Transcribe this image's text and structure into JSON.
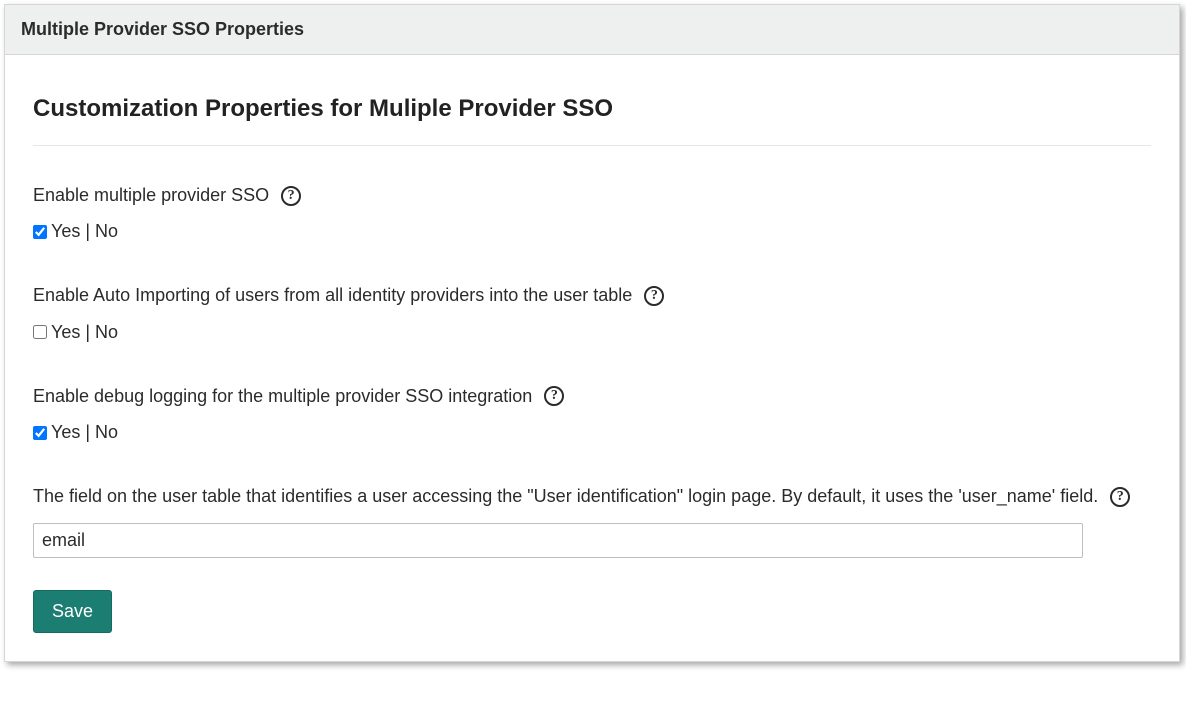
{
  "header": {
    "title": "Multiple Provider SSO Properties"
  },
  "section": {
    "title": "Customization Properties for Muliple Provider SSO"
  },
  "fields": {
    "enableSSO": {
      "label": "Enable multiple provider SSO",
      "yesNoText": "Yes | No",
      "checked": true
    },
    "enableAutoImport": {
      "label": "Enable Auto Importing of users from all identity providers into the user table",
      "yesNoText": "Yes | No",
      "checked": false
    },
    "enableDebug": {
      "label": "Enable debug logging for the multiple provider SSO integration",
      "yesNoText": "Yes | No",
      "checked": true
    },
    "userField": {
      "label": "The field on the user table that identifies a user accessing the \"User identification\" login page. By default, it uses the 'user_name' field.",
      "value": "email"
    }
  },
  "actions": {
    "save": "Save"
  }
}
